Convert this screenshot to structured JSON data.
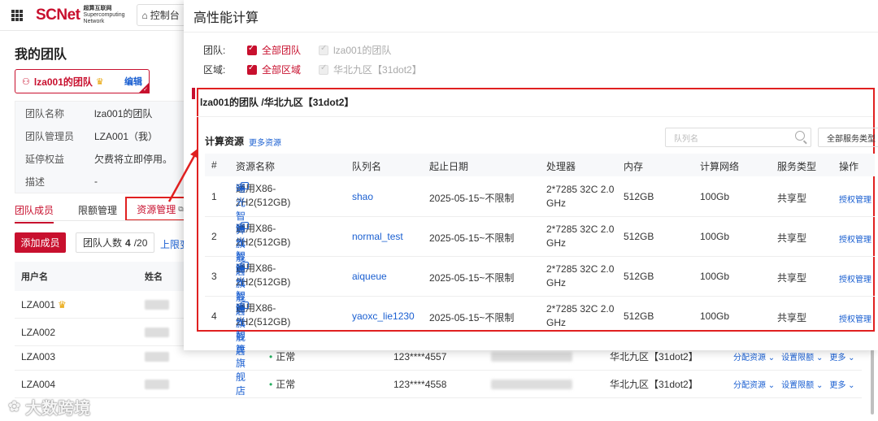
{
  "topbar": {
    "logo_main": "SCNet",
    "logo_sub_1": "超算互联网",
    "logo_sub_2": "Supercomputing",
    "logo_sub_3": "Network",
    "console_label": "控制台"
  },
  "page": {
    "title": "我的团队",
    "team_card": {
      "name": "lza001的团队",
      "edit_label": "编辑"
    },
    "info": [
      {
        "key": "团队名称",
        "value": "lza001的团队"
      },
      {
        "key": "团队管理员",
        "value": "LZA001（我）"
      },
      {
        "key": "延停权益",
        "value": "欠费将立即停用。"
      },
      {
        "key": "描述",
        "value": "-"
      }
    ],
    "tabs": {
      "members": "团队成员",
      "quota": "限额管理",
      "resources": "资源管理"
    },
    "add_member": "添加成员",
    "member_count_label": "团队人数",
    "member_count": "4",
    "member_count_max": "/20",
    "limit_link": "上限变",
    "members_header": {
      "user": "用户名",
      "name": "姓名"
    },
    "members": [
      {
        "user": "LZA001",
        "status": "",
        "phone": "",
        "region": ""
      },
      {
        "user": "LZA002",
        "status": "",
        "phone": "",
        "region": ""
      },
      {
        "user": "LZA003",
        "status": "正常",
        "phone": "123****4557",
        "region": "华北九区【31dot2】"
      },
      {
        "user": "LZA004",
        "status": "正常",
        "phone": "123****4558",
        "region": "华北九区【31dot2】"
      }
    ],
    "row_actions": {
      "alloc": "分配资源 ⌄",
      "limit": "设置限额 ⌄",
      "more": "更多 ⌄"
    }
  },
  "watermark": "大数跨境",
  "panel": {
    "title": "高性能计算",
    "filter_team_label": "团队:",
    "filter_team_all": "全部团队",
    "filter_team_opt": "lza001的团队",
    "filter_region_label": "区域:",
    "filter_region_all": "全部区域",
    "filter_region_opt": "华北九区【31dot2】",
    "scope_title": "lza001的团队 /华北九区【31dot2】",
    "resources_head": "计算资源",
    "more_resources": "更多资源",
    "queue_search_placeholder": "队列名",
    "service_type_btn": "全部服务类型",
    "columns": {
      "idx": "#",
      "res": "资源名称",
      "queue": "队列名",
      "date": "起止日期",
      "cpu": "处理器",
      "mem": "内存",
      "net": "计算网络",
      "svc": "服务类型",
      "op": "操作"
    },
    "rows": [
      {
        "idx": "1",
        "res": "通用X86-2H2(512GB)",
        "store": "曙光智算旗舰店",
        "queue": "shao",
        "date": "2025-05-15~不限制",
        "cpu": "2*7285 32C 2.0 GHz",
        "mem": "512GB",
        "net": "100Gb",
        "svc": "共享型",
        "op": "授权管理"
      },
      {
        "idx": "2",
        "res": "通用X86-2H2(512GB)",
        "store": "曙光智算旗舰店",
        "queue": "normal_test",
        "date": "2025-05-15~不限制",
        "cpu": "2*7285 32C 2.0 GHz",
        "mem": "512GB",
        "net": "100Gb",
        "svc": "共享型",
        "op": "授权管理"
      },
      {
        "idx": "3",
        "res": "通用X86-2H2(512GB)",
        "store": "曙光智算旗舰店",
        "queue": "aiqueue",
        "date": "2025-05-15~不限制",
        "cpu": "2*7285 32C 2.0 GHz",
        "mem": "512GB",
        "net": "100Gb",
        "svc": "共享型",
        "op": "授权管理"
      },
      {
        "idx": "4",
        "res": "通用X86-2H2(512GB)",
        "store": "曙光智算旗舰店",
        "queue": "yaoxc_lie1230",
        "date": "2025-05-15~不限制",
        "cpu": "2*7285 32C 2.0 GHz",
        "mem": "512GB",
        "net": "100Gb",
        "svc": "共享型",
        "op": "授权管理"
      }
    ],
    "store_chevron": "›"
  },
  "colors": {
    "brand_red": "#c8102e",
    "link_blue": "#1a5fd1",
    "highlight_red": "#e02020"
  }
}
